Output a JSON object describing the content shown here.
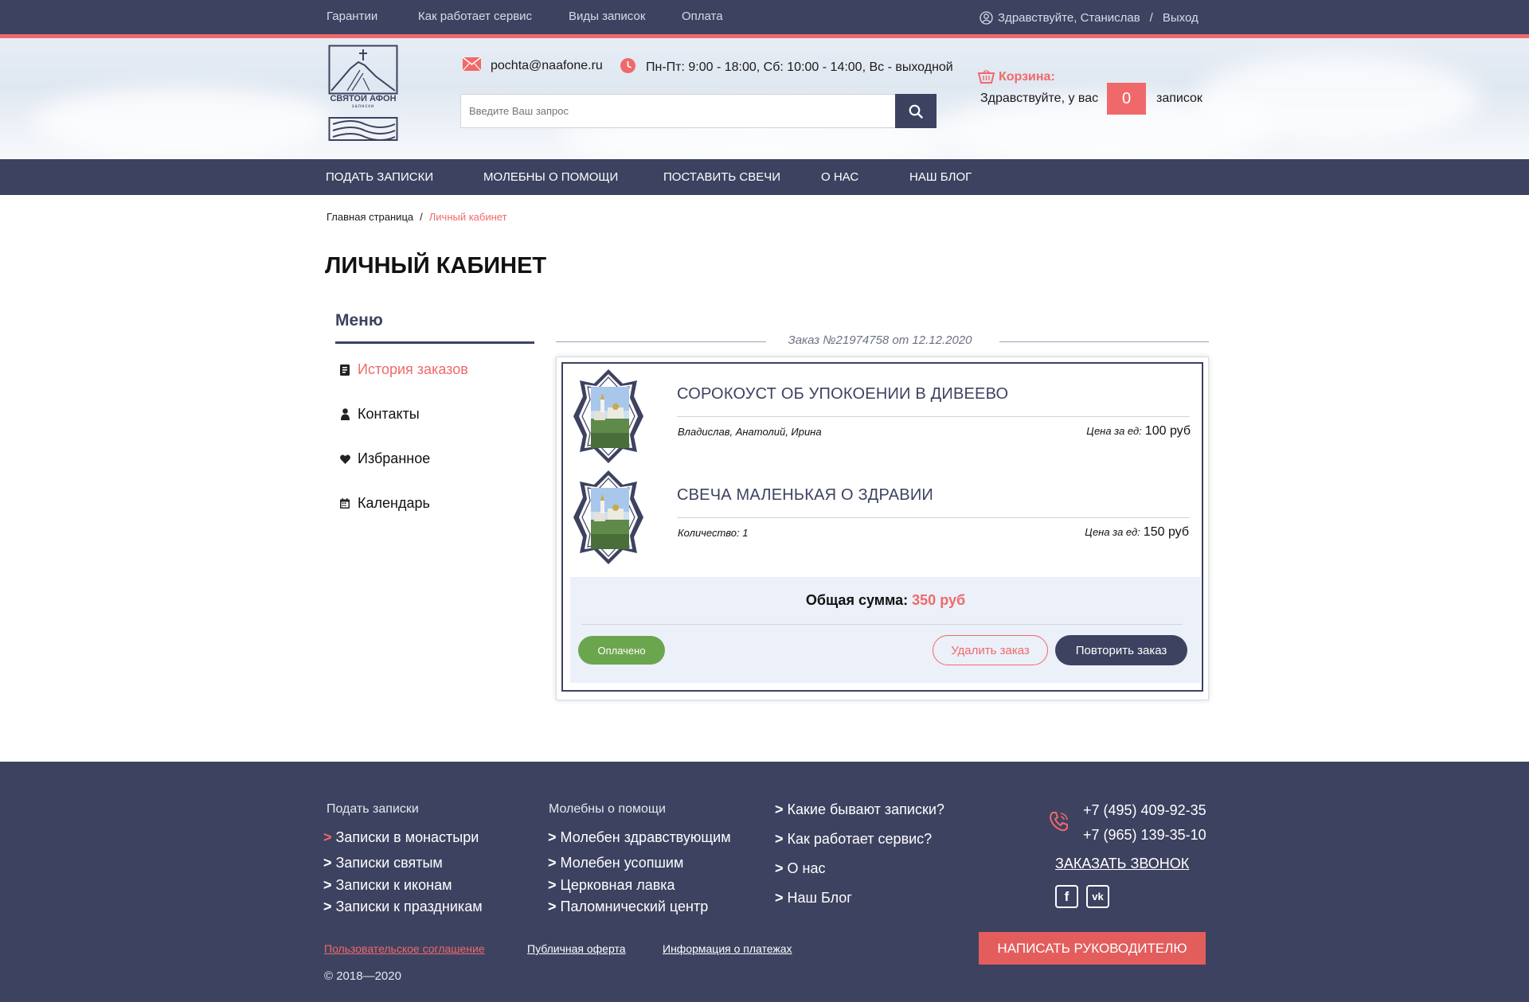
{
  "topnav": {
    "links": [
      "Гарантии",
      "Как работает сервис",
      "Виды записок",
      "Оплата"
    ],
    "greeting": "Здравствуйте, Станислав",
    "separator": "/",
    "logout": "Выход"
  },
  "header": {
    "logo_title": "СВЯТОЙ АФОН",
    "logo_subtitle": "записки",
    "email": "pochta@naafone.ru",
    "hours": "Пн-Пт: 9:00 - 18:00, Сб: 10:00 - 14:00, Вс - выходной",
    "search_placeholder": "Введите Ваш запрос",
    "cart_title": "Корзина:",
    "cart_greeting": "Здравствуйте, у вас",
    "cart_count": "0",
    "cart_suffix": "записок"
  },
  "mainnav": [
    "Подать записки",
    "Молебны о помощи",
    "Поставить свечи",
    "О нас",
    "Наш блог"
  ],
  "breadcrumb": {
    "home": "Главная страница",
    "separator": "/",
    "current": "Личный кабинет"
  },
  "page_title": "ЛИЧНЫЙ КАБИНЕТ",
  "sidebar": {
    "title": "Меню",
    "items": [
      {
        "label": "История заказов",
        "icon": "receipt-icon"
      },
      {
        "label": "Контакты",
        "icon": "user-icon"
      },
      {
        "label": "Избранное",
        "icon": "heart-icon"
      },
      {
        "label": "Календарь",
        "icon": "calendar-icon"
      }
    ]
  },
  "order": {
    "heading": "Заказ №21974758 от 12.12.2020",
    "items": [
      {
        "title": "Сорокоуст об упокоении в Дивеево",
        "detail": "Владислав, Анатолий, Ирина",
        "price_label": "Цена за ед:",
        "price": "100 руб"
      },
      {
        "title": "Свеча маленькая о здравии",
        "detail": "Количество: 1",
        "price_label": "Цена за ед:",
        "price": "150 руб"
      }
    ],
    "total_label": "Общая сумма:",
    "total_value": "350 руб",
    "status": "Оплачено",
    "delete_label": "Удалить заказ",
    "repeat_label": "Повторить заказ"
  },
  "footer": {
    "col1": {
      "heading": "Подать записки",
      "links": [
        "Записки в монастыри",
        "Записки святым",
        "Записки к иконам",
        "Записки к праздникам"
      ]
    },
    "col2": {
      "heading": "Молебны о помощи",
      "links": [
        "Молебен здравствующим",
        "Молебен усопшим",
        "Церковная лавка",
        "Паломнический центр"
      ]
    },
    "col3": {
      "links": [
        "Какие бывают записки?",
        "Как работает сервис?",
        "О нас",
        "Наш Блог"
      ]
    },
    "phones": [
      "+7 (495) 409-92-35",
      "+7 (965) 139-35-10"
    ],
    "call_label": "Заказать звонок",
    "write_label": "Написать руководителю",
    "legal": [
      "Пользовательское соглашение",
      "Публичная оферта",
      "Информация о платежах"
    ],
    "copyright": "© 2018—2020"
  },
  "colors": {
    "navy": "#3d4260",
    "accent": "#f0696a",
    "paid": "#6ba64f"
  }
}
